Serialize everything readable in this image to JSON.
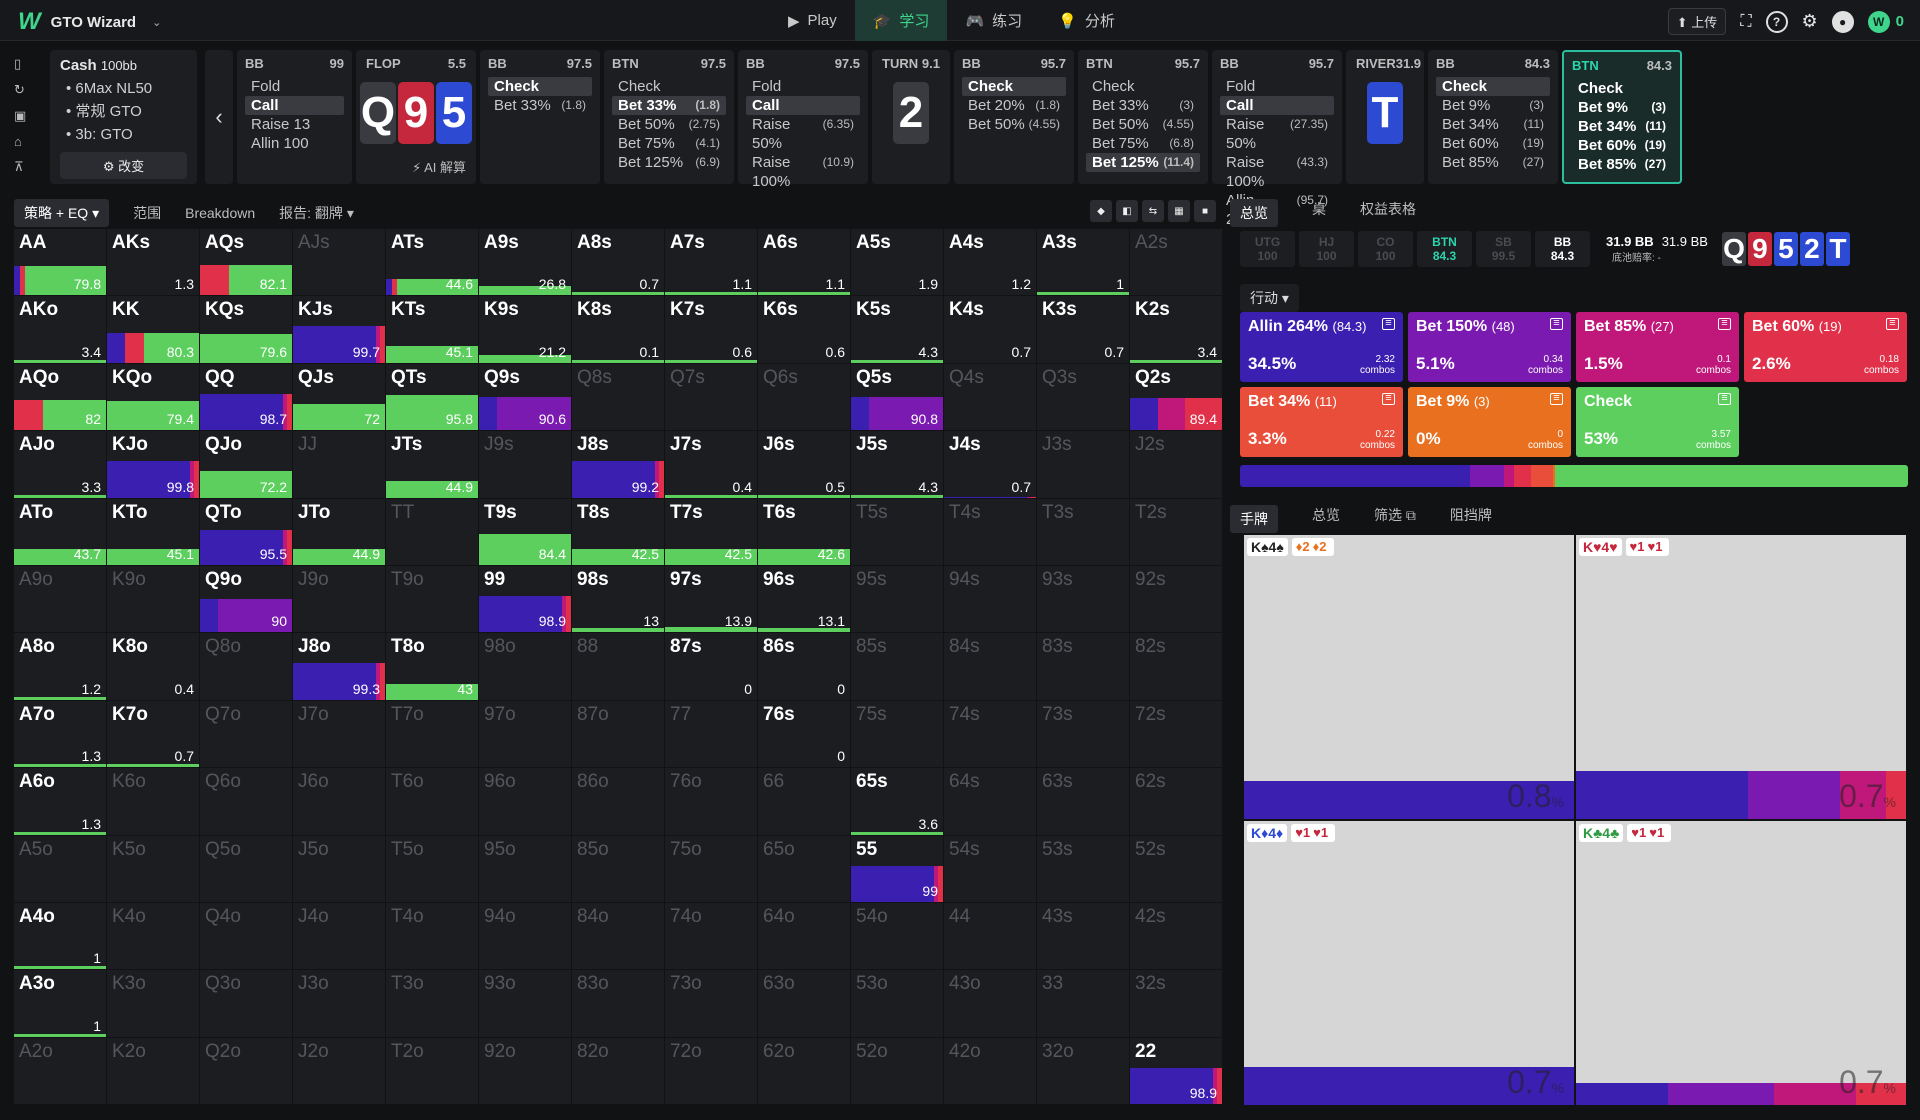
{
  "app": {
    "title": "GTO Wizard"
  },
  "nav": {
    "tabs": [
      {
        "label": "Play",
        "icon": "play-icon"
      },
      {
        "label": "学习",
        "icon": "study-icon",
        "active": true
      },
      {
        "label": "练习",
        "icon": "gamepad-icon"
      },
      {
        "label": "分析",
        "icon": "bulb-icon"
      }
    ]
  },
  "topright": {
    "upload": "⬆ 上传",
    "coins": "0"
  },
  "game": {
    "title": "Cash",
    "stack": "100bb",
    "items": [
      "6Max NL50",
      "常规 GTO",
      "3b: GTO"
    ],
    "change": "⚙ 改变"
  },
  "history": [
    {
      "pos": "BB",
      "stack": "99",
      "acts": [
        {
          "l": "Fold"
        },
        {
          "l": "Call",
          "sel": true
        },
        {
          "l": "Raise 13"
        },
        {
          "l": "Allin 100"
        }
      ]
    },
    {
      "street": "FLOP",
      "pot": "5.5",
      "cards": [
        [
          "Q",
          "s"
        ],
        [
          "9",
          "h"
        ],
        [
          "5",
          "d"
        ]
      ],
      "ai": "⚡ AI 解算"
    },
    {
      "pos": "BB",
      "stack": "97.5",
      "acts": [
        {
          "l": "Check",
          "sel": true
        },
        {
          "l": "Bet 33%",
          "sz": "(1.8)"
        }
      ]
    },
    {
      "pos": "BTN",
      "stack": "97.5",
      "acts": [
        {
          "l": "Check"
        },
        {
          "l": "Bet 33%",
          "sz": "(1.8)",
          "sel": true
        },
        {
          "l": "Bet 50%",
          "sz": "(2.75)"
        },
        {
          "l": "Bet 75%",
          "sz": "(4.1)"
        },
        {
          "l": "Bet 125%",
          "sz": "(6.9)"
        }
      ]
    },
    {
      "pos": "BB",
      "stack": "97.5",
      "acts": [
        {
          "l": "Fold"
        },
        {
          "l": "Call",
          "sel": true
        },
        {
          "l": "Raise 50%",
          "sz": "(6.35)"
        },
        {
          "l": "Raise 100%",
          "sz": "(10.9)"
        }
      ]
    },
    {
      "street": "TURN",
      "pot": "9.1",
      "cards": [
        [
          "2",
          "s"
        ]
      ]
    },
    {
      "pos": "BB",
      "stack": "95.7",
      "acts": [
        {
          "l": "Check",
          "sel": true
        },
        {
          "l": "Bet 20%",
          "sz": "(1.8)"
        },
        {
          "l": "Bet 50%",
          "sz": "(4.55)"
        }
      ]
    },
    {
      "pos": "BTN",
      "stack": "95.7",
      "acts": [
        {
          "l": "Check"
        },
        {
          "l": "Bet 33%",
          "sz": "(3)"
        },
        {
          "l": "Bet 50%",
          "sz": "(4.55)"
        },
        {
          "l": "Bet 75%",
          "sz": "(6.8)"
        },
        {
          "l": "Bet 125%",
          "sz": "(11.4)",
          "sel": true
        }
      ]
    },
    {
      "pos": "BB",
      "stack": "95.7",
      "acts": [
        {
          "l": "Fold"
        },
        {
          "l": "Call",
          "sel": true
        },
        {
          "l": "Raise 50%",
          "sz": "(27.35)"
        },
        {
          "l": "Raise 100%",
          "sz": "(43.3)"
        },
        {
          "l": "Allin 264%",
          "sz": "(95.7)"
        }
      ]
    },
    {
      "street": "RIVER",
      "pot": "31.9",
      "cards": [
        [
          "T",
          "d"
        ]
      ]
    },
    {
      "pos": "BB",
      "stack": "84.3",
      "acts": [
        {
          "l": "Check",
          "sel": true
        },
        {
          "l": "Bet 9%",
          "sz": "(3)"
        },
        {
          "l": "Bet 34%",
          "sz": "(11)"
        },
        {
          "l": "Bet 60%",
          "sz": "(19)"
        },
        {
          "l": "Bet 85%",
          "sz": "(27)"
        }
      ]
    },
    {
      "pos": "BTN",
      "stack": "84.3",
      "cur": true,
      "acts": [
        {
          "l": "Check"
        },
        {
          "l": "Bet 9%",
          "sz": "(3)"
        },
        {
          "l": "Bet 34%",
          "sz": "(11)"
        },
        {
          "l": "Bet 60%",
          "sz": "(19)"
        },
        {
          "l": "Bet 85%",
          "sz": "(27)"
        }
      ]
    }
  ],
  "leftTabs": [
    "策略 + EQ ▾",
    "范围",
    "Breakdown",
    "报告: 翻牌 ▾"
  ],
  "colors": {
    "allin": "#3a1fb0",
    "bet150": "#7a1ab0",
    "bet85": "#c0187a",
    "bet60": "#e0304a",
    "bet34": "#e84e3a",
    "bet9": "#e8701e",
    "check": "#5ccf5e"
  },
  "grid": [
    [
      "AA|79.8|a",
      "AKs|1.3|a",
      "AQs|82.1|r",
      "AJs||d",
      "ATs|44.6|a",
      "A9s|26.8|",
      "A8s|0.7|",
      "A7s|1.1|",
      "A6s|1.1|",
      "A5s|1.9|a",
      "A4s|1.2|m",
      "A3s|1|",
      "A2s||d"
    ],
    [
      "AKo|3.4|",
      "KK|80.3|k",
      "KQs|79.6|c",
      "KJs|99.7|v",
      "KTs|45.1|c",
      "K9s|21.2|",
      "K8s|0.1|",
      "K7s|0.6|",
      "K6s|0.6|v",
      "K5s|4.3|",
      "K4s|0.7|v",
      "K3s|0.7|v",
      "K2s|3.4|"
    ],
    [
      "AQo|82|r",
      "KQo|79.4|c",
      "QQ|98.7|v",
      "QJs|72|c",
      "QTs|95.8|",
      "Q9s|90.6|p",
      "Q8s||d",
      "Q7s||d",
      "Q6s||d",
      "Q5s|90.8|p",
      "Q4s||d",
      "Q3s||d",
      "Q2s|89.4|m"
    ],
    [
      "AJo|3.3|",
      "KJo|99.8|v",
      "QJo|72.2|c",
      "JJ||d",
      "JTs|44.9|c",
      "J9s||d",
      "J8s|99.2|v",
      "J7s|0.4|",
      "J6s|0.5|",
      "J5s|4.3|",
      "J4s|0.7|v",
      "J3s||d",
      "J2s||d"
    ],
    [
      "ATo|43.7|c",
      "KTo|45.1|c",
      "QTo|95.5|v",
      "JTo|44.9|c",
      "TT||d",
      "T9s|84.4|",
      "T8s|42.5|c",
      "T7s|42.5|c",
      "T6s|42.6|c",
      "T5s||d",
      "T4s||d",
      "T3s||d",
      "T2s||d"
    ],
    [
      "A9o||d",
      "K9o||d",
      "Q9o|90|p",
      "J9o||d",
      "T9o||d",
      "99|98.9|v",
      "98s|13|",
      "97s|13.9|",
      "96s|13.1|",
      "95s||d",
      "94s||d",
      "93s||d",
      "92s||d"
    ],
    [
      "A8o|1.2|",
      "K8o|0.4|v",
      "Q8o||d",
      "J8o|99.3|v",
      "T8o|43|c",
      "98o||d",
      "88||d",
      "87s|0|v",
      "86s|0|v",
      "85s||d",
      "84s||d",
      "83s||d",
      "82s||d"
    ],
    [
      "A7o|1.3|",
      "K7o|0.7|",
      "Q7o||d",
      "J7o||d",
      "T7o||d",
      "97o||d",
      "87o||d",
      "77||d",
      "76s|0|v",
      "75s||d",
      "74s||d",
      "73s||d",
      "72s||d"
    ],
    [
      "A6o|1.3|",
      "K6o||d",
      "Q6o||d",
      "J6o||d",
      "T6o||d",
      "96o||d",
      "86o||d",
      "76o||d",
      "66||d",
      "65s|3.6|",
      "64s||d",
      "63s||d",
      "62s||d"
    ],
    [
      "A5o||d",
      "K5o||d",
      "Q5o||d",
      "J5o||d",
      "T5o||d",
      "95o||d",
      "85o||d",
      "75o||d",
      "65o||d",
      "55|99|v",
      "54s||d",
      "53s||d",
      "52s||d"
    ],
    [
      "A4o|1|",
      "K4o||d",
      "Q4o||d",
      "J4o||d",
      "T4o||d",
      "94o||d",
      "84o||d",
      "74o||d",
      "64o||d",
      "54o||d",
      "44||d",
      "43s||d",
      "42s||d"
    ],
    [
      "A3o|1|",
      "K3o||d",
      "Q3o||d",
      "J3o||d",
      "T3o||d",
      "93o||d",
      "83o||d",
      "73o||d",
      "63o||d",
      "53o||d",
      "43o||d",
      "33||d",
      "32s||d"
    ],
    [
      "A2o||d",
      "K2o||d",
      "Q2o||d",
      "J2o||d",
      "T2o||d",
      "92o||d",
      "82o||d",
      "72o||d",
      "62o||d",
      "52o||d",
      "42o||d",
      "32o||d",
      "22|98.9|v"
    ]
  ],
  "rightTabs": [
    "总览",
    "桌",
    "权益表格"
  ],
  "positions": [
    {
      "p": "UTG",
      "v": "100"
    },
    {
      "p": "HJ",
      "v": "100"
    },
    {
      "p": "CO",
      "v": "100"
    },
    {
      "p": "BTN",
      "v": "84.3",
      "on": true
    },
    {
      "p": "SB",
      "v": "99.5"
    },
    {
      "p": "BB",
      "v": "84.3",
      "w": true
    }
  ],
  "pot": {
    "a": "31.9 BB",
    "b": "31.9 BB",
    "sub": "底池赔率: -"
  },
  "boardRight": [
    [
      "Q",
      "s"
    ],
    [
      "9",
      "h"
    ],
    [
      "5",
      "d"
    ],
    [
      "2",
      "d"
    ],
    [
      "T",
      "d"
    ]
  ],
  "actionDropdown": "行动 ▾",
  "actions": [
    {
      "label": "Allin 264%",
      "size": "(84.3)",
      "pct": "34.5%",
      "combos": "2.32",
      "unit": "combos",
      "color": "#3a1fb0"
    },
    {
      "label": "Bet 150%",
      "size": "(48)",
      "pct": "5.1%",
      "combos": "0.34",
      "unit": "combos",
      "color": "#7a1ab0"
    },
    {
      "label": "Bet 85%",
      "size": "(27)",
      "pct": "1.5%",
      "combos": "0.1",
      "unit": "combos",
      "color": "#c0187a"
    },
    {
      "label": "Bet 60%",
      "size": "(19)",
      "pct": "2.6%",
      "combos": "0.18",
      "unit": "combos",
      "color": "#e0304a"
    },
    {
      "label": "Bet 34%",
      "size": "(11)",
      "pct": "3.3%",
      "combos": "0.22",
      "unit": "combos",
      "color": "#e84e3a"
    },
    {
      "label": "Bet 9%",
      "size": "(3)",
      "pct": "0%",
      "combos": "0",
      "unit": "combos",
      "color": "#e8701e"
    },
    {
      "label": "Check",
      "size": "",
      "pct": "53%",
      "combos": "3.57",
      "unit": "combos",
      "color": "#5ccf5e"
    }
  ],
  "handTabs": [
    "手牌",
    "总览",
    "筛选 ⧉",
    "阻挡牌"
  ],
  "combos": [
    {
      "hand": "K♠4♠",
      "blk": [
        "♦2",
        "♦2"
      ],
      "value": "0.8",
      "unit": "%"
    },
    {
      "hand": "K♥4♥",
      "blk": [
        "♥1",
        "♥1"
      ],
      "value": "0.7",
      "unit": "%"
    },
    {
      "hand": "K♦4♦",
      "blk": [
        "♥1",
        "♥1"
      ],
      "value": "0.7",
      "unit": "%"
    },
    {
      "hand": "K♣4♣",
      "blk": [
        "♥1",
        "♥1"
      ],
      "value": "0.7",
      "unit": "%"
    }
  ]
}
